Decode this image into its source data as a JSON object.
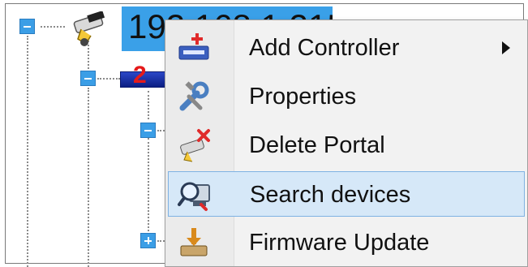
{
  "tree": {
    "root_label": "192.168.1.215",
    "portal_number": "2"
  },
  "context_menu": {
    "items": [
      {
        "label": "Add Controller",
        "icon": "add-controller-icon",
        "has_submenu": true
      },
      {
        "label": "Properties",
        "icon": "properties-wrench-icon"
      },
      {
        "label": "Delete Portal",
        "icon": "delete-portal-icon"
      },
      {
        "label": "Search devices",
        "icon": "search-devices-icon",
        "highlighted": true
      },
      {
        "label": "Firmware Update",
        "icon": "firmware-update-icon"
      }
    ]
  },
  "colors": {
    "highlight_bg": "#d6e8f8",
    "highlight_border": "#7fb2e3",
    "tree_node_blue": "#3aa0e8",
    "expander_blue": "#3b9ee6"
  }
}
